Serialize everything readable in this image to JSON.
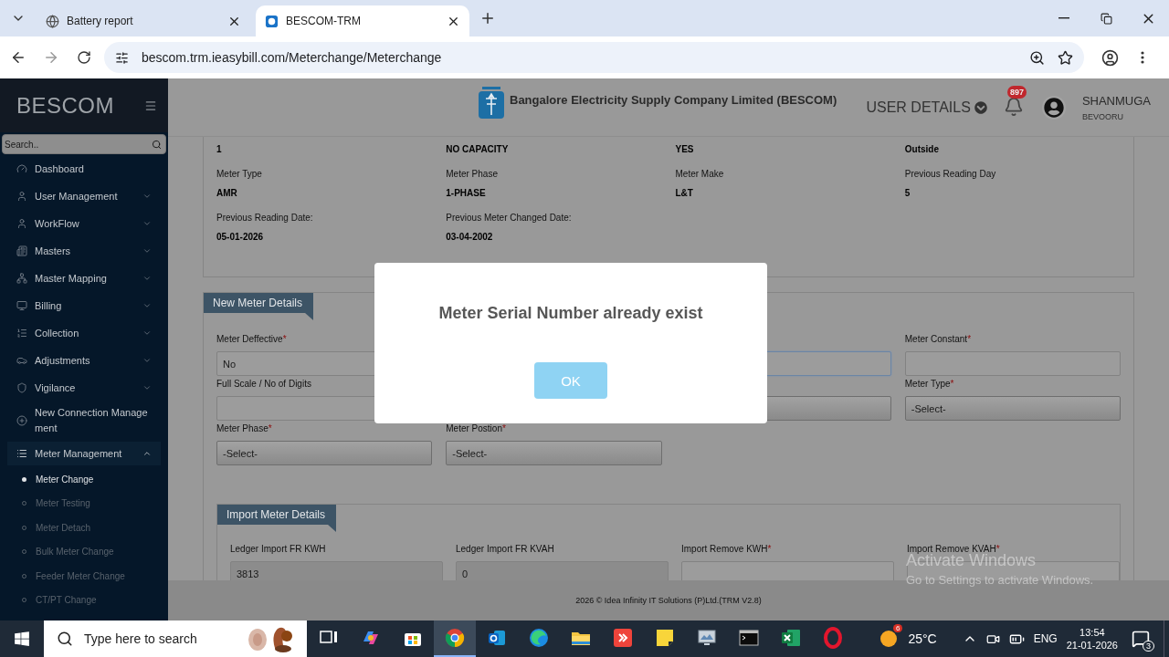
{
  "browser": {
    "tabs": [
      {
        "title": "Battery report",
        "selected": false
      },
      {
        "title": "BESCOM-TRM",
        "selected": true
      }
    ],
    "url": "bescom.trm.ieasybill.com/Meterchange/Meterchange"
  },
  "sidebar": {
    "brand": "BESCOM",
    "search_placeholder": "Search..",
    "items": [
      {
        "label": "Dashboard",
        "kind": "link"
      },
      {
        "label": "User Management",
        "kind": "group",
        "expanded": false
      },
      {
        "label": "WorkFlow",
        "kind": "group",
        "expanded": false
      },
      {
        "label": "Masters",
        "kind": "group",
        "expanded": false
      },
      {
        "label": "Master Mapping",
        "kind": "group",
        "expanded": false
      },
      {
        "label": "Billing",
        "kind": "group",
        "expanded": false
      },
      {
        "label": "Collection",
        "kind": "group",
        "expanded": false
      },
      {
        "label": "Adjustments",
        "kind": "group",
        "expanded": false
      },
      {
        "label": "Vigilance",
        "kind": "group",
        "expanded": false
      },
      {
        "label": "New Connection Management",
        "kind": "link"
      },
      {
        "label": "Meter Management",
        "kind": "group",
        "expanded": true,
        "children": [
          {
            "label": "Meter Change",
            "selected": true
          },
          {
            "label": "Meter Testing",
            "selected": false
          },
          {
            "label": "Meter Detach",
            "selected": false
          },
          {
            "label": "Bulk Meter Change",
            "selected": false
          },
          {
            "label": "Feeder Meter Change",
            "selected": false
          },
          {
            "label": "CT/PT Change",
            "selected": false
          }
        ]
      }
    ]
  },
  "header": {
    "company": "Bangalore Electricity Supply Company Limited (BESCOM)",
    "user_details": "USER DETAILS",
    "notifications": "897",
    "user_name": "SHANMUGA",
    "user_location": "BEVOORU"
  },
  "meter_info": {
    "values_row": [
      "1",
      "NO CAPACITY",
      "YES",
      "Outside"
    ],
    "fields": [
      {
        "label": "Meter Type",
        "value": "AMR"
      },
      {
        "label": "Meter Phase",
        "value": "1-PHASE"
      },
      {
        "label": "Meter Make",
        "value": "L&T"
      },
      {
        "label": "Previous Reading Day",
        "value": "5"
      },
      {
        "label": "Previous Reading Date:",
        "value": "05-01-2026"
      },
      {
        "label": "Previous Meter Changed Date:",
        "value": "03-04-2002"
      }
    ]
  },
  "new_meter_details": {
    "title": "New Meter Details",
    "fields": [
      {
        "kind": "input",
        "label": "Meter Deffective",
        "mark": "*",
        "value": "No",
        "focused": false
      },
      {
        "kind": "covered"
      },
      {
        "kind": "input",
        "focused": true
      },
      {
        "kind": "input",
        "label": "Meter Constant",
        "mark": "*",
        "focused": false
      },
      {
        "kind": "input",
        "label": "Full Scale / No of Digits",
        "focused": false
      },
      {
        "kind": "covered"
      },
      {
        "kind": "select",
        "focused": false
      },
      {
        "kind": "select",
        "label": "Meter Type",
        "mark": "*",
        "value": "-Select-",
        "focused": false
      },
      {
        "kind": "select",
        "label": "Meter Phase",
        "mark": "*",
        "value": "-Select-",
        "focused": false
      },
      {
        "kind": "select",
        "label": "Meter Postion",
        "mark": "*",
        "value": "-Select-",
        "focused": false
      }
    ]
  },
  "import_meter_details": {
    "title": "Import Meter Details",
    "fields": [
      {
        "label": "Ledger Import FR KWH",
        "value": "3813",
        "readonly": true
      },
      {
        "label": "Ledger Import FR KVAH",
        "value": "0",
        "readonly": true
      },
      {
        "label": "Import Remove KWH",
        "mark": "*",
        "readonly": false
      },
      {
        "label": "Import Remove KVAH",
        "mark": "*",
        "readonly": false
      }
    ]
  },
  "footer": "2026 © Idea Infinity IT Solutions (P)Ltd.(TRM V2.8)",
  "modal": {
    "message": "Meter Serial Number already exist",
    "button": "OK"
  },
  "activation": {
    "title": "Activate Windows",
    "text": "Go to Settings to activate Windows."
  },
  "taskbar": {
    "search_placeholder": "Type here to search",
    "apps": [
      {
        "kind": "task_view",
        "selected": false
      },
      {
        "kind": "assistant",
        "selected": false
      },
      {
        "kind": "store",
        "selected": false
      },
      {
        "kind": "chrome",
        "selected": true
      },
      {
        "kind": "mail",
        "selected": false
      },
      {
        "kind": "edge",
        "selected": false
      },
      {
        "kind": "files",
        "selected": false
      },
      {
        "kind": "remote",
        "selected": false
      },
      {
        "kind": "notes",
        "selected": false
      },
      {
        "kind": "monitor",
        "selected": false
      },
      {
        "kind": "terminal",
        "selected": false
      },
      {
        "kind": "spreadsheet",
        "selected": false
      },
      {
        "kind": "ring",
        "selected": false
      }
    ],
    "weather": {
      "badge": "6",
      "temperature": "25°C"
    },
    "language": "ENG",
    "time": "13:54",
    "date": "21-01-2026",
    "notifications": "3"
  }
}
